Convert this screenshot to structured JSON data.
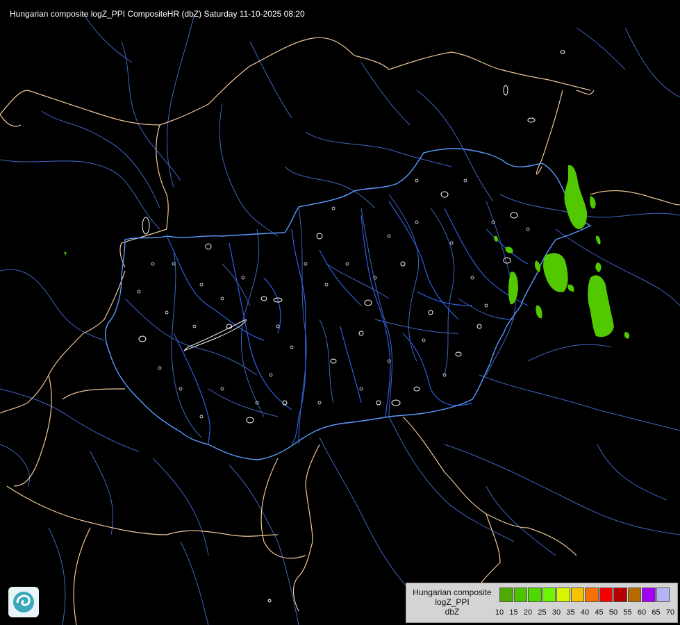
{
  "title": "Hungarian composite logZ_PPI CompositeHR (dbZ) Saturday 11-10-2025 08:20",
  "legend": {
    "line1": "Hungarian composite",
    "line2": "logZ_PPI",
    "line3": "dbZ",
    "colors": [
      "#4caa00",
      "#4cc400",
      "#4cd800",
      "#6cf400",
      "#d8f400",
      "#f4c400",
      "#f47000",
      "#f40000",
      "#b40000",
      "#b46c00",
      "#a000f4",
      "#b4b4f4"
    ],
    "ticks": [
      "10",
      "15",
      "20",
      "25",
      "30",
      "35",
      "40",
      "45",
      "50",
      "55",
      "60",
      "65",
      "70"
    ]
  },
  "colors": {
    "border_country": "#f0c89a",
    "border_hungary": "#5aa0ff",
    "rivers": "#4c74d8",
    "lakes": "#ffffff",
    "echo": "#5cc400"
  }
}
